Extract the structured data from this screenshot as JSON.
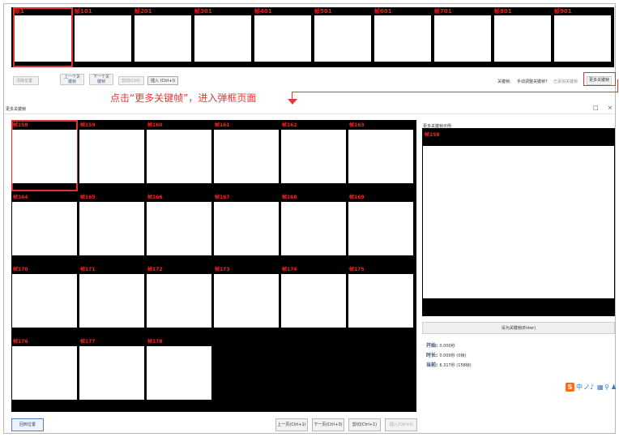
{
  "top_strip": {
    "thumbs": [
      {
        "label": "帧1"
      },
      {
        "label": "帧101"
      },
      {
        "label": "帧201"
      },
      {
        "label": "帧301"
      },
      {
        "label": "帧401"
      },
      {
        "label": "帧501"
      },
      {
        "label": "帧601"
      },
      {
        "label": "帧701"
      },
      {
        "label": "帧801"
      },
      {
        "label": "帧901"
      }
    ]
  },
  "toolbar": {
    "reset": "清除位置",
    "prev_kf": "上一个关键帧",
    "next_kf": "下一个关键帧",
    "cut": "剪切(Ctrl)",
    "insert": "插入 (Ctrl+I)",
    "kf_label": "关键帧:",
    "kf_option1": "手动调整关键帧?",
    "kf_option2": "已添加关键帧",
    "more_kf": "更多关键帧"
  },
  "annotation": {
    "text": "点击“更多关键帧”，进入弹框页面"
  },
  "dialog": {
    "title": "更多关键帧",
    "restore_icon": "□",
    "close_icon": "×",
    "grid_cells": [
      "帧158",
      "帧159",
      "帧160",
      "帧161",
      "帧162",
      "帧163",
      "帧164",
      "帧165",
      "帧166",
      "帧167",
      "帧168",
      "帧169",
      "帧170",
      "帧171",
      "帧172",
      "帧173",
      "帧174",
      "帧175",
      "帧176",
      "帧177",
      "帧178"
    ],
    "preview_label": "更多关键帧示例",
    "preview_frame": "帧158",
    "set_kf_button": "设为关键帧(Enter)",
    "info": [
      {
        "key": "开始:",
        "value": "0.000秒"
      },
      {
        "key": "时长:",
        "value": "0.000秒 (0帧)"
      },
      {
        "key": "当前:",
        "value": "6.317秒 (158帧)"
      }
    ],
    "ime": {
      "logo": "S",
      "items": [
        "中",
        "ノ",
        "♪",
        "▦",
        "⚲",
        "♟"
      ]
    },
    "buttons": {
      "reset": "回到位置",
      "prev_page": "上一页(Ctrl+1)",
      "next_page": "下一页(Ctrl+3)",
      "cut": "剪切(Ctrl+1)",
      "insert": "插入(Ctrl+I)"
    }
  },
  "colors": {
    "accent_red": "#e03131",
    "frame_label_red": "#ff1a1a"
  }
}
